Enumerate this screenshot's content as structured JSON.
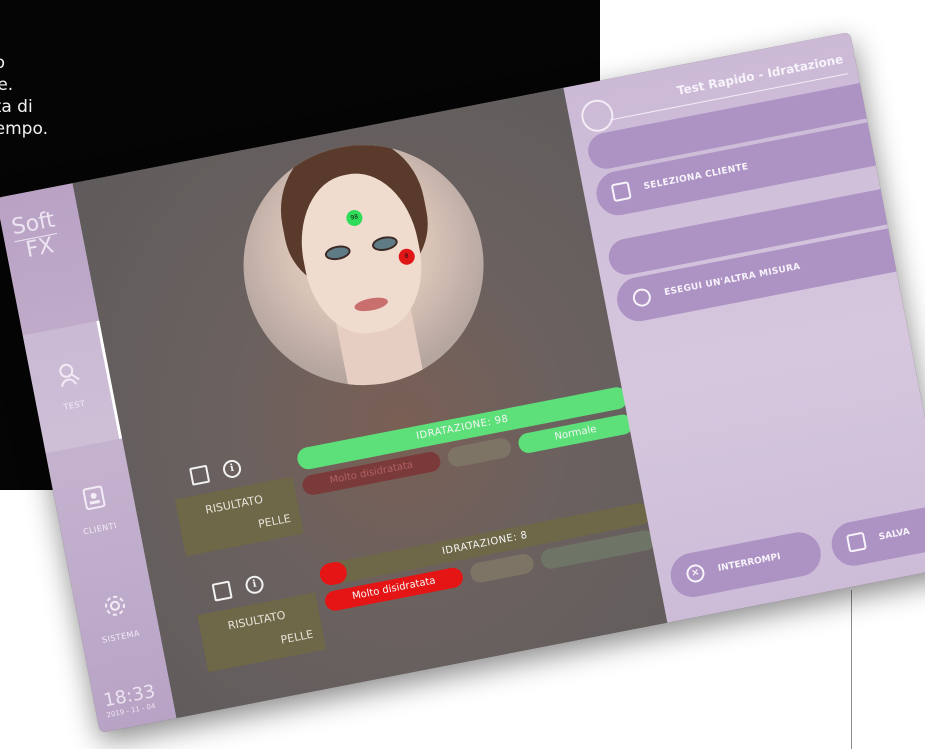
{
  "side_caption": {
    "lines": [
      "to",
      "ce.",
      "tta di",
      "tempo."
    ]
  },
  "sidebar": {
    "logo_top": "Soft",
    "logo_bottom": "FX",
    "items": [
      {
        "label": "TEST",
        "icon": "test-icon",
        "active": true
      },
      {
        "label": "CLIENTI",
        "icon": "clients-icon",
        "active": false
      },
      {
        "label": "SISTEMA",
        "icon": "gear-icon",
        "active": false
      }
    ],
    "clock": "18:33",
    "date": "2019 - 11 - 04"
  },
  "results": [
    {
      "label_top": "RISULTATO",
      "label_bottom": "PELLE",
      "bar_label": "IDRATAZIONE: 98",
      "hydration": 98,
      "status": "Normale",
      "status_color": "#5de07a",
      "secondary": "Molto disidratata"
    },
    {
      "label_top": "RISULTATO",
      "label_bottom": "PELLE",
      "bar_label": "IDRATAZIONE: 8",
      "hydration": 8,
      "status": "Molto disidratata",
      "status_color": "#e51515"
    }
  ],
  "face_points": [
    {
      "value": "98",
      "color": "#2fdc5a"
    },
    {
      "value": "8",
      "color": "#e01616"
    }
  ],
  "panel": {
    "title": "Test Rapido - Idratazione",
    "select_client": "SELEZIONA CLIENTE",
    "another_measure": "ESEGUI UN'ALTRA MISURA",
    "interrupt": "INTERROMPI",
    "save": "SALVA"
  },
  "colors": {
    "accent_purple": "#ad92c4",
    "panel_bg": "#d6c7de",
    "green": "#5de07a",
    "red": "#e51515",
    "olive": "#6e6748"
  }
}
